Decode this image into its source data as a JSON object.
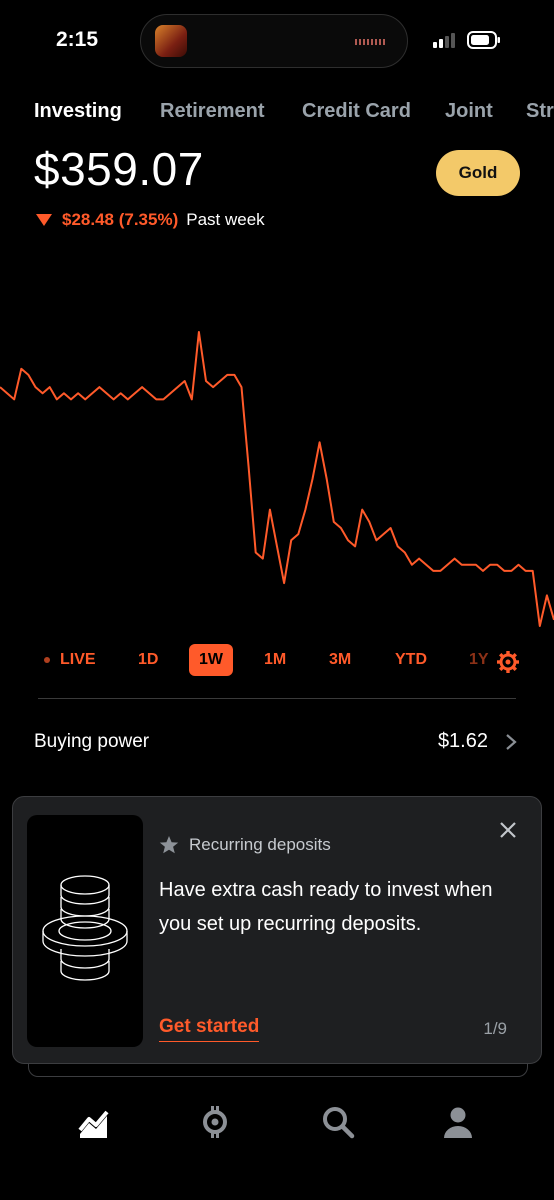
{
  "status_bar": {
    "time": "2:15"
  },
  "tabs": [
    {
      "label": "Investing",
      "active": true
    },
    {
      "label": "Retirement",
      "active": false
    },
    {
      "label": "Credit Card",
      "active": false
    },
    {
      "label": "Joint",
      "active": false
    },
    {
      "label": "Str",
      "active": false
    }
  ],
  "portfolio": {
    "value": "$359.07",
    "gold_label": "Gold",
    "change_amount": "$28.48 (7.35%)",
    "change_period": "Past week",
    "change_direction": "down"
  },
  "colors": {
    "accent": "#ff5a2a",
    "gold": "#f3c969",
    "card_bg": "#1e1f21"
  },
  "chart_data": {
    "type": "line",
    "title": "",
    "series": [
      {
        "values": [
          330,
          329,
          328,
          333,
          332,
          330,
          329,
          330,
          328,
          329,
          328,
          329,
          328,
          329,
          330,
          329,
          328,
          329,
          328,
          329,
          330,
          329,
          328,
          328,
          329,
          330,
          331,
          328,
          339,
          331,
          330,
          331,
          332,
          332,
          330,
          317,
          303,
          302,
          310,
          304,
          298,
          305,
          306,
          310,
          315,
          321,
          315,
          308,
          307,
          305,
          304,
          310,
          308,
          305,
          306,
          307,
          304,
          303,
          301,
          302,
          301,
          300,
          300,
          301,
          302,
          301,
          301,
          301,
          300,
          301,
          301,
          300,
          300,
          301,
          300,
          300,
          291,
          296,
          292
        ]
      }
    ],
    "color": "#ff5a2a",
    "grid": false
  },
  "ranges": [
    {
      "label": "LIVE",
      "active": false
    },
    {
      "label": "1D",
      "active": false
    },
    {
      "label": "1W",
      "active": true
    },
    {
      "label": "1M",
      "active": false
    },
    {
      "label": "3M",
      "active": false
    },
    {
      "label": "YTD",
      "active": false
    },
    {
      "label": "1Y",
      "active": false
    }
  ],
  "buying_power": {
    "label": "Buying power",
    "value": "$1.62"
  },
  "promo_card": {
    "heading": "Recurring deposits",
    "body": "Have extra cash ready to invest when you set up recurring deposits.",
    "cta": "Get started",
    "pager": "1/9"
  },
  "bottom_nav": [
    {
      "icon": "chart-trend-icon",
      "active": true
    },
    {
      "icon": "crypto-icon",
      "active": false
    },
    {
      "icon": "search-icon",
      "active": false
    },
    {
      "icon": "account-icon",
      "active": false
    }
  ]
}
